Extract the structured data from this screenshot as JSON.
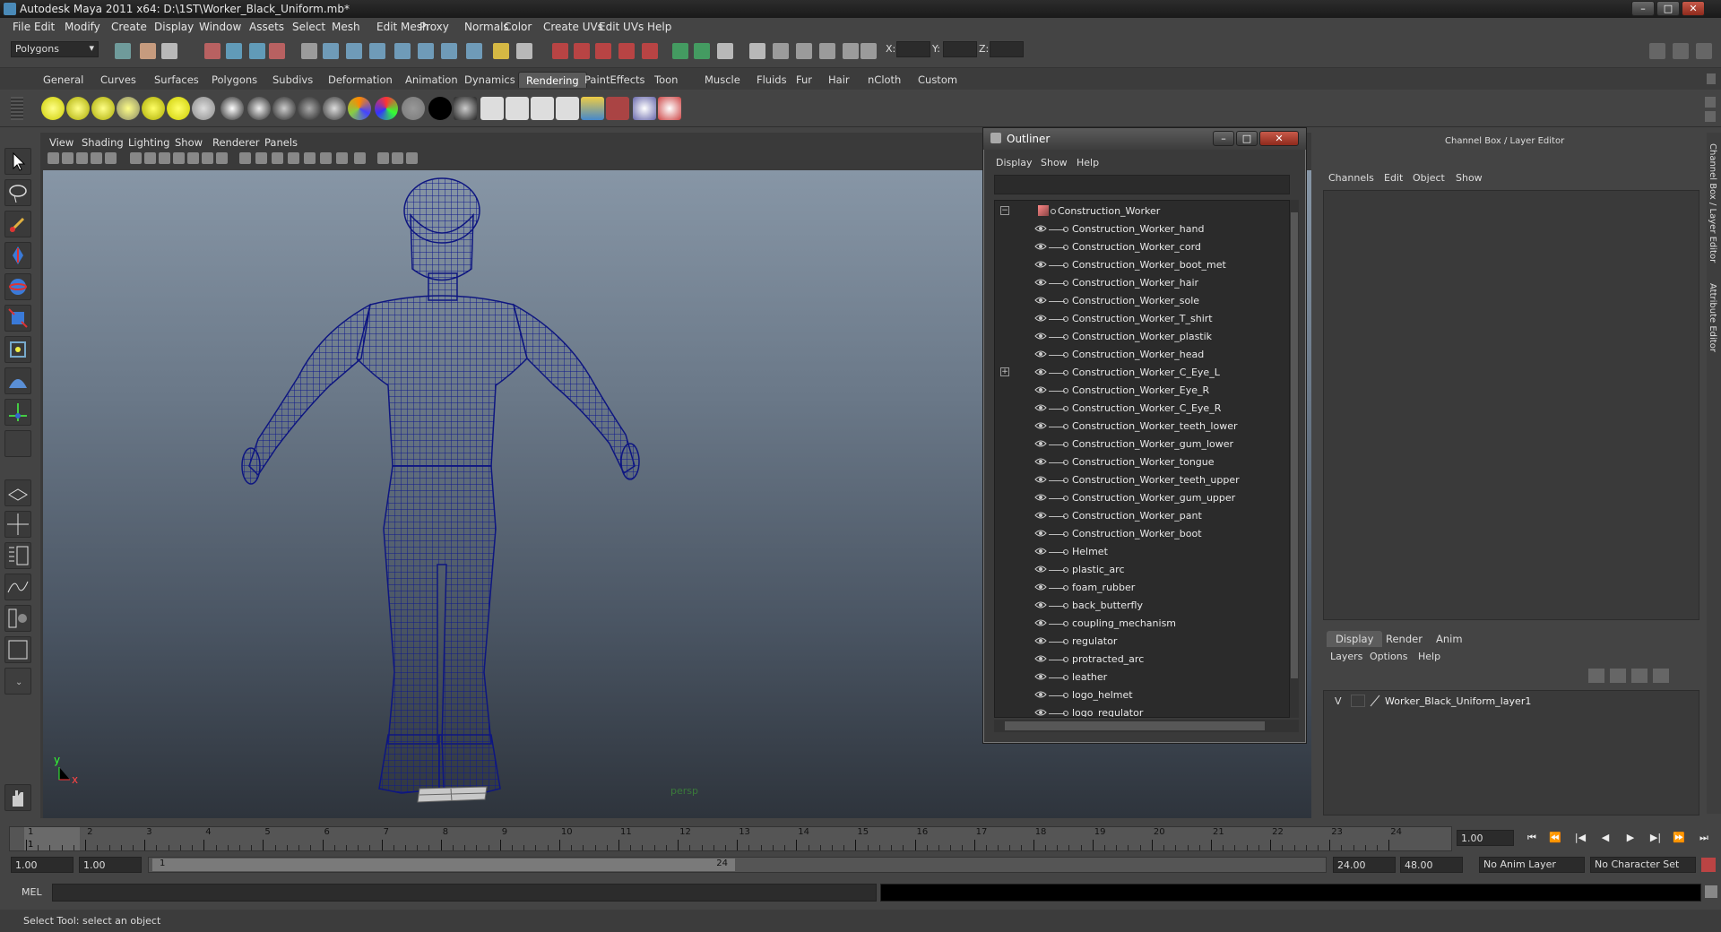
{
  "window": {
    "title": "Autodesk Maya 2011 x64: D:\\1ST\\Worker_Black_Uniform.mb*"
  },
  "menubar": [
    "File",
    "Edit",
    "Modify",
    "Create",
    "Display",
    "Window",
    "Assets",
    "Select",
    "Mesh",
    "Edit Mesh",
    "Proxy",
    "Normals",
    "Color",
    "Create UVs",
    "Edit UVs",
    "Help"
  ],
  "status": {
    "mode": "Polygons",
    "x_label": "X:",
    "y_label": "Y:",
    "z_label": "Z:"
  },
  "shelf_tabs": [
    "General",
    "Curves",
    "Surfaces",
    "Polygons",
    "Subdivs",
    "Deformation",
    "Animation",
    "Dynamics",
    "Rendering",
    "PaintEffects",
    "Toon",
    "Muscle",
    "Fluids",
    "Fur",
    "Hair",
    "nCloth",
    "Custom"
  ],
  "shelf_active": "Rendering",
  "viewport": {
    "menus": [
      "View",
      "Shading",
      "Lighting",
      "Show",
      "Renderer",
      "Panels"
    ],
    "camera_label": "persp",
    "axis_y": "y",
    "axis_x": "x"
  },
  "outliner": {
    "title": "Outliner",
    "menus": [
      "Display",
      "Show",
      "Help"
    ],
    "root": "Construction_Worker",
    "items": [
      "Construction_Worker_hand",
      "Construction_Worker_cord",
      "Construction_Worker_boot_met",
      "Construction_Worker_hair",
      "Construction_Worker_sole",
      "Construction_Worker_T_shirt",
      "Construction_Worker_plastik",
      "Construction_Worker_head",
      "Construction_Worker_C_Eye_L",
      "Construction_Worker_Eye_R",
      "Construction_Worker_C_Eye_R",
      "Construction_Worker_teeth_lower",
      "Construction_Worker_gum_lower",
      "Construction_Worker_tongue",
      "Construction_Worker_teeth_upper",
      "Construction_Worker_gum_upper",
      "Construction_Worker_pant",
      "Construction_Worker_boot",
      "Helmet",
      "plastic_arc",
      "foam_rubber",
      "back_butterfly",
      "coupling_mechanism",
      "regulator",
      "protracted_arc",
      "leather",
      "logo_helmet",
      "logo_regulator"
    ]
  },
  "channelbox": {
    "title": "Channel Box / Layer Editor",
    "menus": [
      "Channels",
      "Edit",
      "Object",
      "Show"
    ],
    "side_tabs": [
      "Channel Box / Layer Editor",
      "Attribute Editor"
    ]
  },
  "layer_editor": {
    "tabs": [
      "Display",
      "Render",
      "Anim"
    ],
    "active_tab": "Display",
    "menus": [
      "Layers",
      "Options",
      "Help"
    ],
    "layer_visible": "V",
    "layer_name": "Worker_Black_Uniform_layer1"
  },
  "timeline": {
    "ticks": [
      "1",
      "2",
      "3",
      "4",
      "5",
      "6",
      "7",
      "8",
      "9",
      "10",
      "11",
      "12",
      "13",
      "14",
      "15",
      "16",
      "17",
      "18",
      "19",
      "20",
      "21",
      "22",
      "23",
      "24"
    ],
    "current_frame_marker": "1",
    "current_time": "1.00"
  },
  "range": {
    "start_time": "1.00",
    "playback_start": "1.00",
    "range_start": "1",
    "range_end": "24",
    "playback_end": "24.00",
    "end_time": "48.00",
    "anim_layer": "No Anim Layer",
    "character_set": "No Character Set"
  },
  "cmdline": {
    "label": "MEL"
  },
  "helpline": {
    "text": "Select Tool: select an object"
  }
}
